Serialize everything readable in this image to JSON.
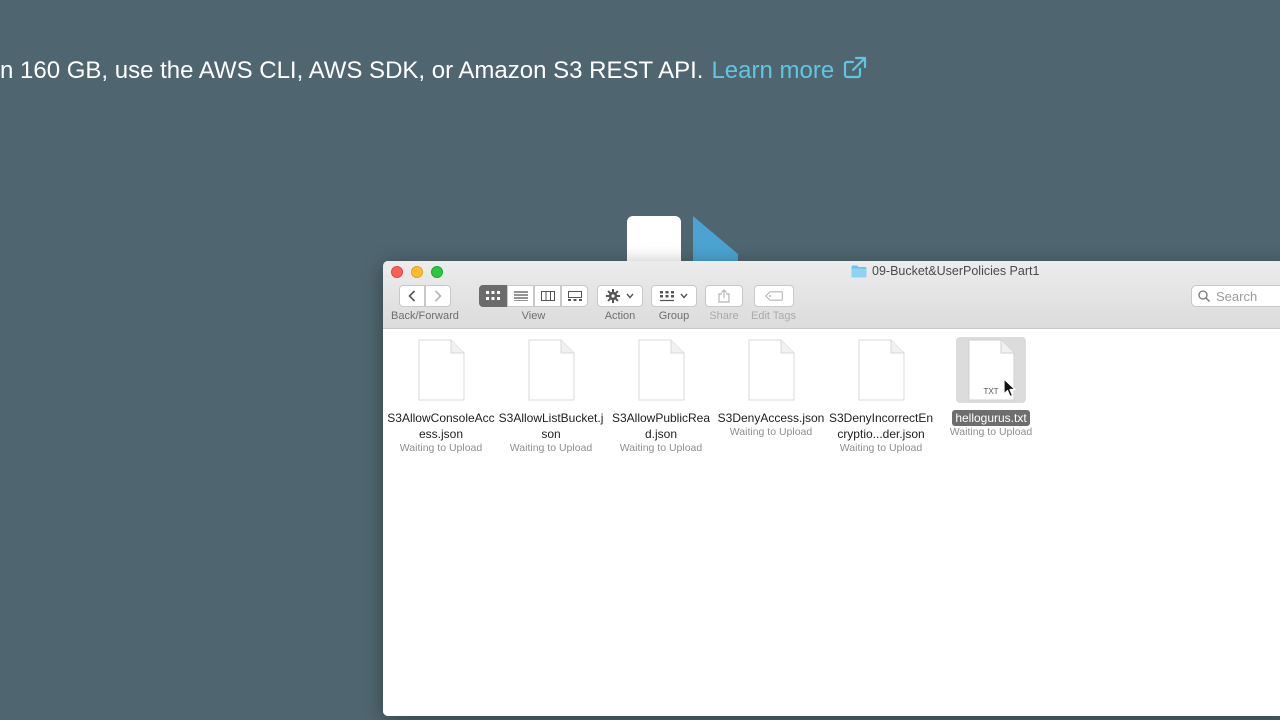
{
  "banner": {
    "text": "n 160 GB, use the AWS CLI, AWS SDK, or Amazon S3 REST API.",
    "link": "Learn more"
  },
  "window": {
    "title": "09-Bucket&UserPolicies Part1"
  },
  "toolbar": {
    "back_forward_label": "Back/Forward",
    "view_label": "View",
    "action_label": "Action",
    "group_label": "Group",
    "share_label": "Share",
    "edit_tags_label": "Edit Tags",
    "search_placeholder": "Search"
  },
  "files": [
    {
      "name": "S3AllowConsoleAccess.json",
      "status": "Waiting to Upload"
    },
    {
      "name": "S3AllowListBucket.json",
      "status": "Waiting to Upload"
    },
    {
      "name": "S3AllowPublicRead.json",
      "status": "Waiting to Upload"
    },
    {
      "name": "S3DenyAccess.json",
      "status": "Waiting to Upload"
    },
    {
      "name": "S3DenyIncorrectEncryptio...der.json",
      "status": "Waiting to Upload"
    },
    {
      "name": "hellogurus.txt",
      "status": "Waiting to Upload",
      "badge": "TXT"
    }
  ],
  "colors": {
    "page_bg": "#4f6670",
    "link": "#5fc6e2",
    "selection": "#6e6e6e"
  }
}
